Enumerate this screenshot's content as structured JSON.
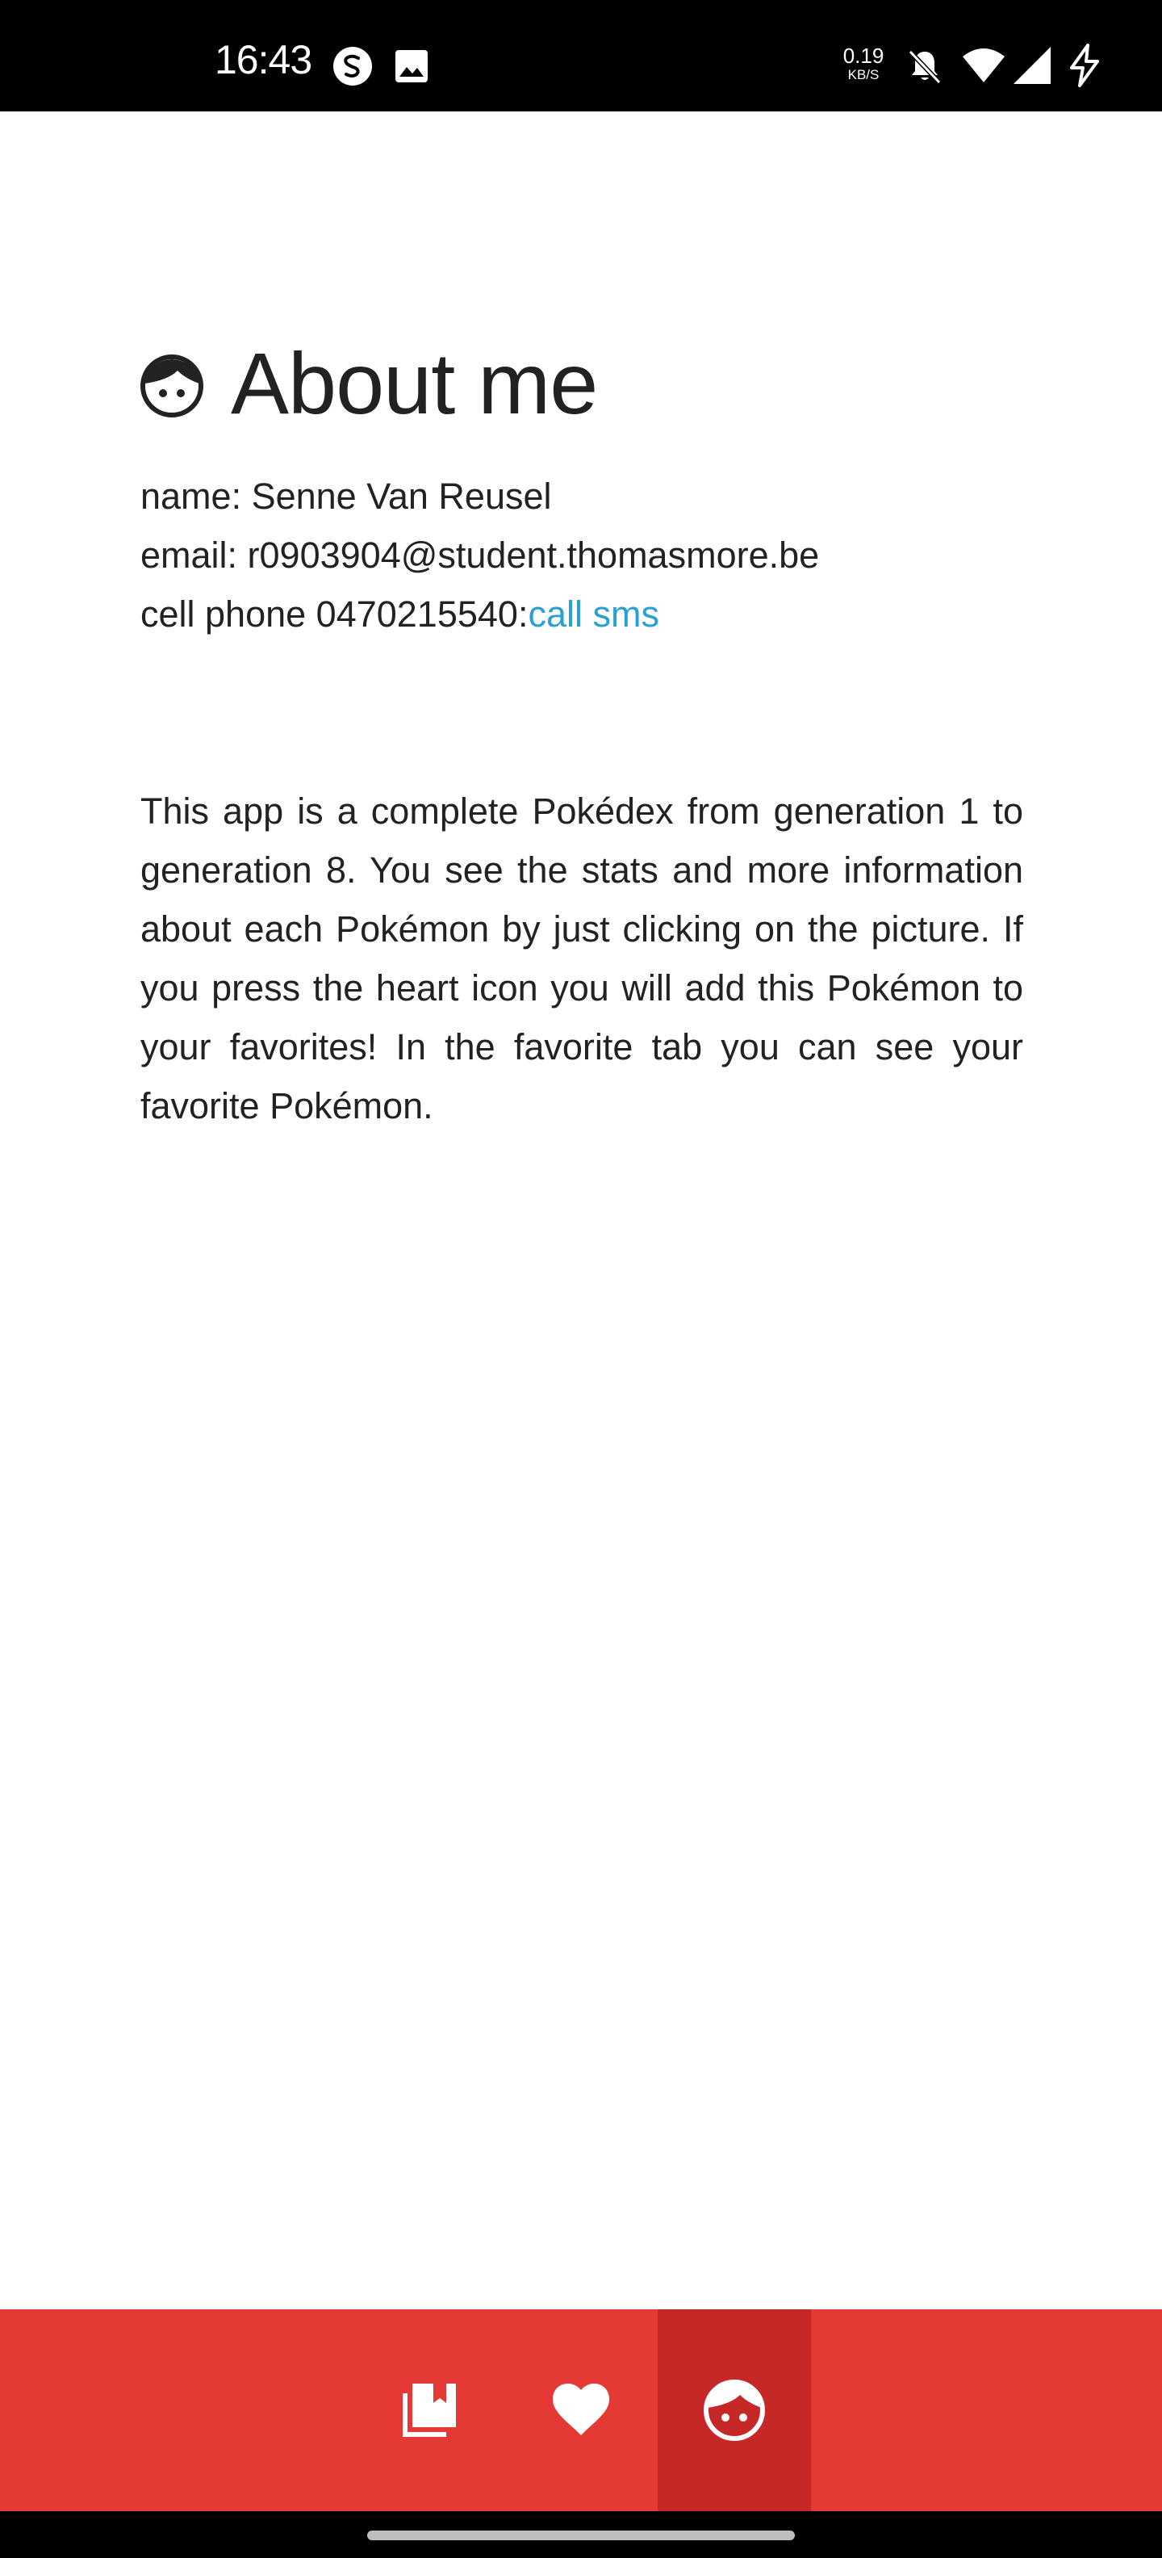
{
  "status_bar": {
    "time": "16:43",
    "net_speed_value": "0.19",
    "net_speed_unit": "KB/S",
    "icons": [
      "s-app-icon",
      "image-icon",
      "bell-off-icon",
      "wifi-icon",
      "signal-icon",
      "charging-icon"
    ]
  },
  "about": {
    "title": "About me",
    "title_icon": "face-icon",
    "name_label": "name: ",
    "name_value": "Senne Van Reusel",
    "email_label": "email: ",
    "email_value": "r0903904@student.thomasmore.be",
    "phone_label": "cell phone ",
    "phone_value": "0470215540",
    "phone_separator": ":",
    "call_link": "call",
    "sms_link": "sms",
    "description": "This app is a complete Pokédex from generation 1 to generation 8. You see the stats and more information about each Pokémon by just clicking on the picture. If you press the heart icon you will add this Pokémon to your favorites! In the favorite tab you can see your favorite Pokémon."
  },
  "bottom_nav": {
    "items": [
      {
        "icon": "collections-bookmark-icon",
        "active": false
      },
      {
        "icon": "heart-icon",
        "active": false
      },
      {
        "icon": "face-icon",
        "active": true
      }
    ],
    "background_color": "#e53935",
    "active_color": "#c62828"
  },
  "colors": {
    "link": "#2aa0d2",
    "text": "#222222"
  }
}
